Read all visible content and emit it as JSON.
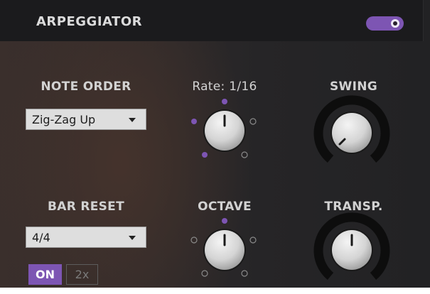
{
  "header": {
    "title": "ARPEGGIATOR",
    "power_on": true
  },
  "note_order": {
    "label": "NOTE ORDER",
    "value": "Zig-Zag Up"
  },
  "bar_reset": {
    "label": "BAR RESET",
    "value": "4/4",
    "on_label": "ON",
    "double_label": "2x"
  },
  "rate": {
    "label": "Rate: 1/16"
  },
  "swing": {
    "label": "SWING"
  },
  "octave": {
    "label": "OCTAVE"
  },
  "transpose": {
    "label": "TRANSP."
  },
  "colors": {
    "accent": "#7d55b3",
    "panel": "#242426",
    "header": "#1b1b1d"
  }
}
